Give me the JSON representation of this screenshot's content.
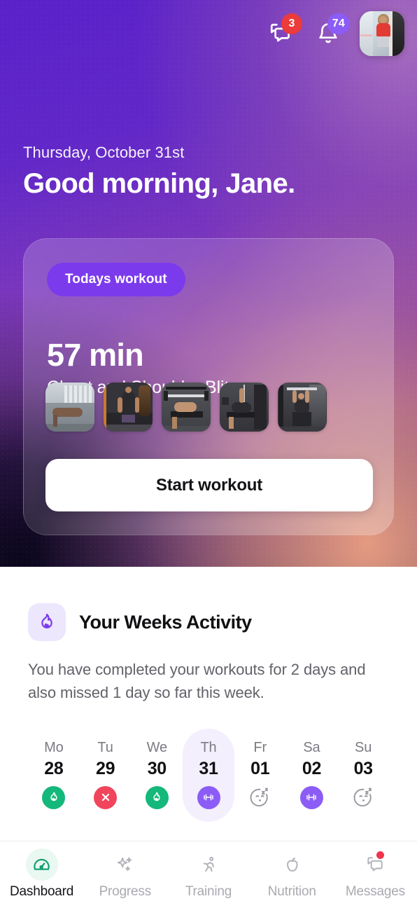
{
  "topbar": {
    "messages_icon": "chat-bubbles-icon",
    "messages_badge": "3",
    "notifications_icon": "bell-icon",
    "notifications_badge": "74",
    "avatar_name": "user-avatar"
  },
  "greeting": {
    "date": "Thursday, October 31st",
    "message": "Good morning, Jane."
  },
  "workout_card": {
    "pill_label": "Todays workout",
    "duration": "57 min",
    "title": "Chest and Shoulder Blitz",
    "start_label": "Start workout",
    "exercises": [
      {
        "name": "push-up-thumbnail"
      },
      {
        "name": "dumbbell-curl-thumbnail"
      },
      {
        "name": "bench-press-thumbnail"
      },
      {
        "name": "incline-press-thumbnail"
      },
      {
        "name": "shoulder-press-thumbnail"
      }
    ]
  },
  "activity": {
    "icon": "flame-icon",
    "title": "Your Weeks Activity",
    "description": "You have completed your workouts for 2 days and also missed 1 day so far this week.",
    "days": [
      {
        "name": "Mo",
        "num": "28",
        "status": "completed",
        "icon": "flame-icon",
        "today": false
      },
      {
        "name": "Tu",
        "num": "29",
        "status": "missed",
        "icon": "close-icon",
        "today": false
      },
      {
        "name": "We",
        "num": "30",
        "status": "completed",
        "icon": "flame-icon",
        "today": false
      },
      {
        "name": "Th",
        "num": "31",
        "status": "planned",
        "icon": "dumbbell-icon",
        "today": true
      },
      {
        "name": "Fr",
        "num": "01",
        "status": "rest",
        "icon": "sleeping-face-icon",
        "today": false
      },
      {
        "name": "Sa",
        "num": "02",
        "status": "planned",
        "icon": "dumbbell-icon",
        "today": false
      },
      {
        "name": "Su",
        "num": "03",
        "status": "rest",
        "icon": "sleeping-face-icon",
        "today": false
      }
    ]
  },
  "nav": {
    "items": [
      {
        "label": "Dashboard",
        "icon": "speedometer-icon",
        "active": true,
        "dot": false
      },
      {
        "label": "Progress",
        "icon": "sparkles-icon",
        "active": false,
        "dot": false
      },
      {
        "label": "Training",
        "icon": "running-person-icon",
        "active": false,
        "dot": false
      },
      {
        "label": "Nutrition",
        "icon": "apple-icon",
        "active": false,
        "dot": false
      },
      {
        "label": "Messages",
        "icon": "chat-bubbles-icon",
        "active": false,
        "dot": true
      }
    ]
  },
  "colors": {
    "brand_purple": "#7c3aed",
    "badge_red": "#ec3b3b",
    "badge_purple": "#8b5cf6",
    "success_green": "#14b87a",
    "miss_red": "#f0455c",
    "dashboard_green": "#0f9d6f"
  }
}
